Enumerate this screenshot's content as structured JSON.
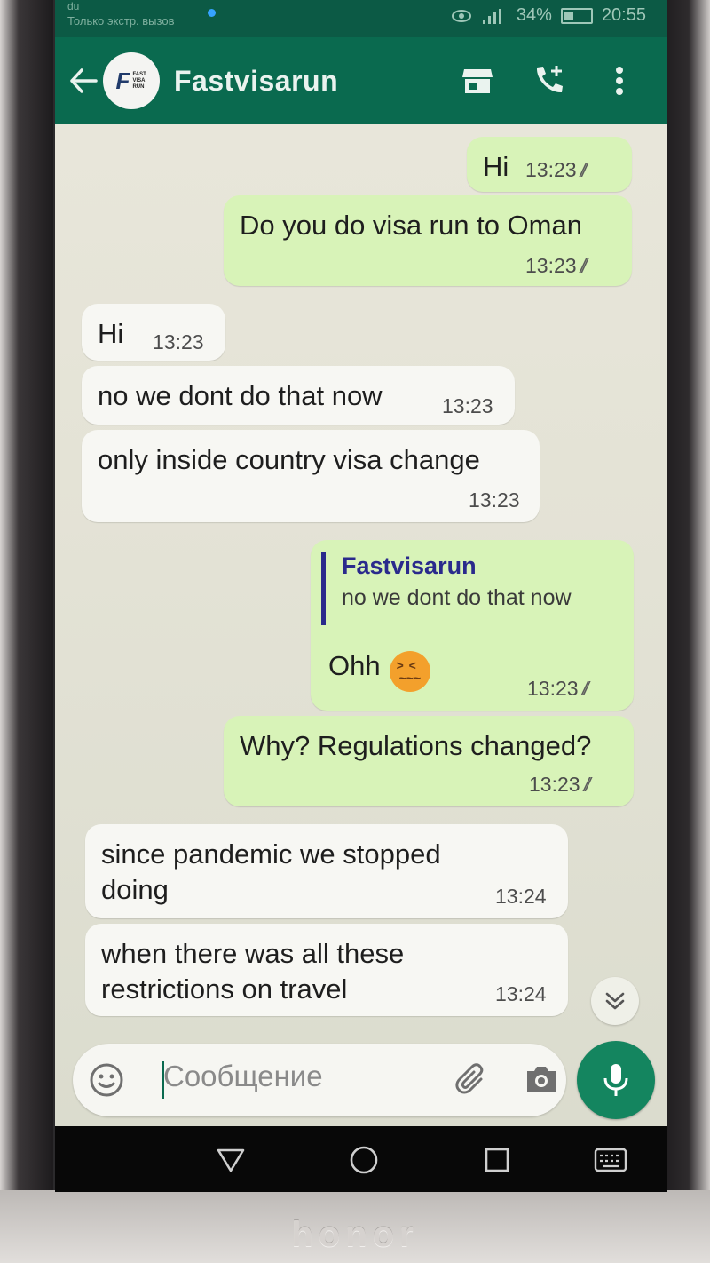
{
  "device": {
    "brand": "honor"
  },
  "status_bar": {
    "carrier": "du",
    "emergency_text": "Только экстр. вызов",
    "battery": "34%",
    "time": "20:55"
  },
  "header": {
    "contact_name": "Fastvisarun",
    "avatar_text": "FAST VISA RUN"
  },
  "messages": [
    {
      "direction": "out",
      "text": "Hi",
      "time": "13:23"
    },
    {
      "direction": "out",
      "text": "Do you do visa run to Oman",
      "time": "13:23"
    },
    {
      "direction": "in",
      "text": "Hi",
      "time": "13:23"
    },
    {
      "direction": "in",
      "text": "no we dont do that now",
      "time": "13:23"
    },
    {
      "direction": "in",
      "text": "only inside country visa change",
      "time": "13:23"
    },
    {
      "direction": "out",
      "reply_to": {
        "name": "Fastvisarun",
        "text": "no we dont do that now"
      },
      "text": "Ohh",
      "emoji": "confounded-face",
      "time": "13:23"
    },
    {
      "direction": "out",
      "text": "Why? Regulations changed?",
      "time": "13:23"
    },
    {
      "direction": "in",
      "text_lines": [
        "since pandemic we stopped",
        "doing"
      ],
      "time": "13:24"
    },
    {
      "direction": "in",
      "text_lines": [
        "when there was all these",
        "restrictions on travel"
      ],
      "time": "13:24"
    }
  ],
  "composer": {
    "placeholder": "Сообщение"
  },
  "colors": {
    "header": "#0a6a4f",
    "outgoing": "#d8f3b8",
    "incoming": "#f7f7f3",
    "accent": "#14855f"
  }
}
